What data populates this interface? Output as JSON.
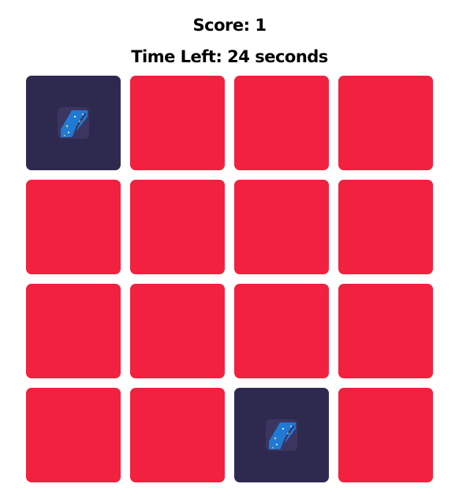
{
  "score": {
    "label": "Score:",
    "value": "1"
  },
  "timer": {
    "label": "Time Left:",
    "value": "24",
    "unit": "seconds"
  },
  "board": {
    "columns": 4,
    "rows": 4,
    "cards": [
      {
        "state": "flipped",
        "icon": "space-road-icon"
      },
      {
        "state": "hidden"
      },
      {
        "state": "hidden"
      },
      {
        "state": "hidden"
      },
      {
        "state": "hidden"
      },
      {
        "state": "hidden"
      },
      {
        "state": "hidden"
      },
      {
        "state": "hidden"
      },
      {
        "state": "hidden"
      },
      {
        "state": "hidden"
      },
      {
        "state": "hidden"
      },
      {
        "state": "hidden"
      },
      {
        "state": "hidden"
      },
      {
        "state": "hidden"
      },
      {
        "state": "flipped",
        "icon": "space-road-icon"
      },
      {
        "state": "hidden"
      }
    ]
  },
  "colors": {
    "card_back": "#f2213f",
    "card_front": "#2e2a4f",
    "icon_blue": "#1f7ad6",
    "icon_bg": "#3b3560",
    "icon_star": "#f5c842"
  }
}
